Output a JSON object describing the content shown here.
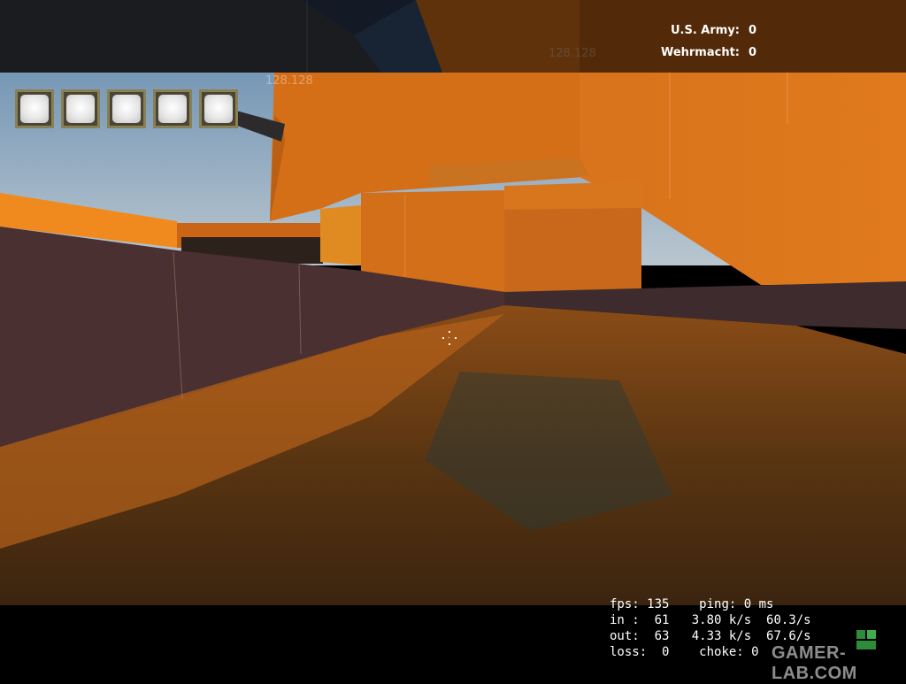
{
  "scoreboard": {
    "teams": [
      {
        "name": "U.S. Army:",
        "score": "0"
      },
      {
        "name": "Wehrmacht:",
        "score": "0"
      }
    ]
  },
  "inventory": {
    "slots": [
      "empty-slot",
      "empty-slot",
      "empty-slot",
      "empty-slot",
      "empty-slot"
    ]
  },
  "netgraph": {
    "fps": "135",
    "ping": "0 ms",
    "in_count": "61",
    "in_rate": "3.80 k/s",
    "in_pps": "60.3/s",
    "out_count": "63",
    "out_rate": "4.33 k/s",
    "out_pps": "67.6/s",
    "loss": "0",
    "choke": "0"
  },
  "wall_labels": [
    "128.128",
    "128.128"
  ],
  "watermark": "GAMER-LAB.COM",
  "colors": {
    "wall_orange": "#d9731c",
    "floor_water": "#6b3a12",
    "sky": "#7fa3c4",
    "slot_border": "#8a8055"
  }
}
